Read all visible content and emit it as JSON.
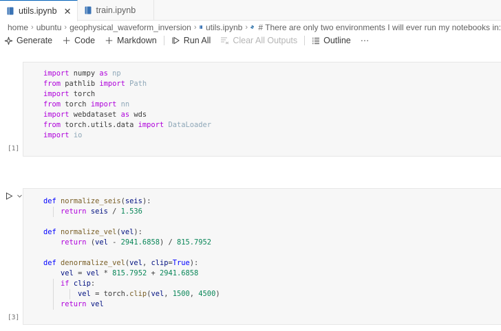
{
  "tabs": [
    {
      "label": "utils.ipynb",
      "active": true,
      "close": "✕"
    },
    {
      "label": "train.ipynb",
      "active": false
    }
  ],
  "breadcrumbs": {
    "items": [
      "home",
      "ubuntu",
      "geophysical_waveform_inversion",
      "utils.ipynb",
      "# There are only two environments I will ever run my notebooks in:"
    ]
  },
  "toolbar": {
    "generate": "Generate",
    "code": "Code",
    "markdown": "Markdown",
    "run_all": "Run All",
    "clear_outputs": "Clear All Outputs",
    "outline": "Outline",
    "more": "···"
  },
  "cells": [
    {
      "execution_count": "[1]",
      "lines": [
        [
          [
            "kw",
            "import"
          ],
          [
            "t",
            " numpy "
          ],
          [
            "kw",
            "as"
          ],
          [
            "t",
            " "
          ],
          [
            "dim",
            "np"
          ]
        ],
        [
          [
            "kw",
            "from"
          ],
          [
            "t",
            " pathlib "
          ],
          [
            "kw",
            "import"
          ],
          [
            "t",
            " "
          ],
          [
            "dim",
            "Path"
          ]
        ],
        [
          [
            "kw",
            "import"
          ],
          [
            "t",
            " torch"
          ]
        ],
        [
          [
            "kw",
            "from"
          ],
          [
            "t",
            " torch "
          ],
          [
            "kw",
            "import"
          ],
          [
            "t",
            " "
          ],
          [
            "dim",
            "nn"
          ]
        ],
        [
          [
            "kw",
            "import"
          ],
          [
            "t",
            " webdataset "
          ],
          [
            "kw",
            "as"
          ],
          [
            "t",
            " wds"
          ]
        ],
        [
          [
            "kw",
            "from"
          ],
          [
            "t",
            " torch.utils.data "
          ],
          [
            "kw",
            "import"
          ],
          [
            "t",
            " "
          ],
          [
            "dim",
            "DataLoader"
          ]
        ],
        [
          [
            "kw",
            "import"
          ],
          [
            "t",
            " "
          ],
          [
            "dim",
            "io"
          ]
        ]
      ]
    },
    {
      "execution_count": "[3]",
      "lines": [
        [
          [
            "def",
            "def"
          ],
          [
            "t",
            " "
          ],
          [
            "fn",
            "normalize_seis"
          ],
          [
            "t",
            "("
          ],
          [
            "var",
            "seis"
          ],
          [
            "t",
            "):"
          ]
        ],
        [
          [
            "t",
            "    "
          ],
          [
            "kw",
            "return"
          ],
          [
            "t",
            " "
          ],
          [
            "var",
            "seis"
          ],
          [
            "t",
            " / "
          ],
          [
            "num",
            "1.536"
          ]
        ],
        [
          [
            "t",
            ""
          ]
        ],
        [
          [
            "def",
            "def"
          ],
          [
            "t",
            " "
          ],
          [
            "fn",
            "normalize_vel"
          ],
          [
            "t",
            "("
          ],
          [
            "var",
            "vel"
          ],
          [
            "t",
            "):"
          ]
        ],
        [
          [
            "t",
            "    "
          ],
          [
            "kw",
            "return"
          ],
          [
            "t",
            " ("
          ],
          [
            "var",
            "vel"
          ],
          [
            "t",
            " - "
          ],
          [
            "num",
            "2941.6858"
          ],
          [
            "t",
            ") / "
          ],
          [
            "num",
            "815.7952"
          ]
        ],
        [
          [
            "t",
            ""
          ]
        ],
        [
          [
            "def",
            "def"
          ],
          [
            "t",
            " "
          ],
          [
            "fn",
            "denormalize_vel"
          ],
          [
            "t",
            "("
          ],
          [
            "var",
            "vel"
          ],
          [
            "t",
            ", "
          ],
          [
            "var",
            "clip"
          ],
          [
            "t",
            "="
          ],
          [
            "def",
            "True"
          ],
          [
            "t",
            "):"
          ]
        ],
        [
          [
            "t",
            "    "
          ],
          [
            "var",
            "vel"
          ],
          [
            "t",
            " = "
          ],
          [
            "var",
            "vel"
          ],
          [
            "t",
            " * "
          ],
          [
            "num",
            "815.7952"
          ],
          [
            "t",
            " + "
          ],
          [
            "num",
            "2941.6858"
          ]
        ],
        [
          [
            "t",
            "    "
          ],
          [
            "kw",
            "if"
          ],
          [
            "t",
            " "
          ],
          [
            "var",
            "clip"
          ],
          [
            "t",
            ":"
          ]
        ],
        [
          [
            "t",
            "        "
          ],
          [
            "var",
            "vel"
          ],
          [
            "t",
            " = "
          ],
          [
            "t",
            "torch."
          ],
          [
            "fn",
            "clip"
          ],
          [
            "t",
            "("
          ],
          [
            "var",
            "vel"
          ],
          [
            "t",
            ", "
          ],
          [
            "num",
            "1500"
          ],
          [
            "t",
            ", "
          ],
          [
            "num",
            "4500"
          ],
          [
            "t",
            ")"
          ]
        ],
        [
          [
            "t",
            "    "
          ],
          [
            "kw",
            "return"
          ],
          [
            "t",
            " "
          ],
          [
            "var",
            "vel"
          ]
        ]
      ]
    }
  ]
}
